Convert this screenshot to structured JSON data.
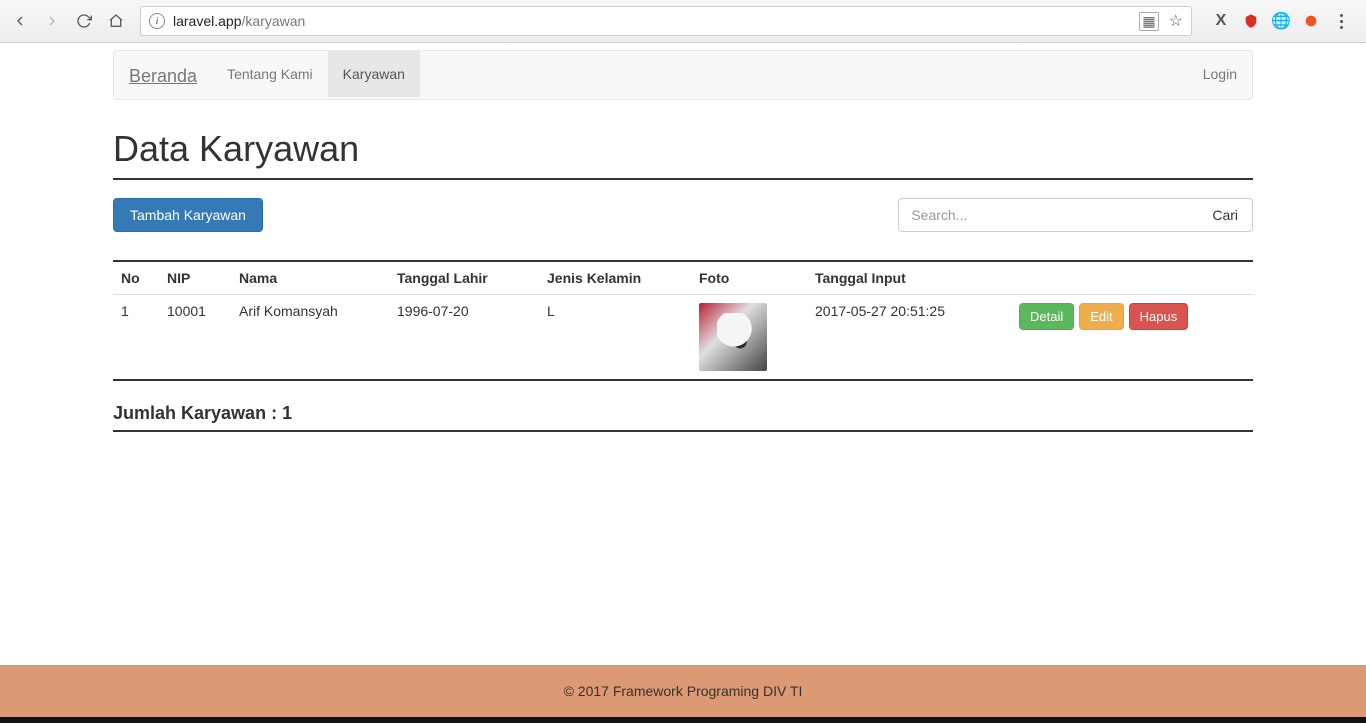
{
  "browser": {
    "url_host": "laravel.app",
    "url_path": "/karyawan"
  },
  "nav": {
    "brand": "Beranda",
    "items": [
      {
        "label": "Tentang Kami",
        "active": false
      },
      {
        "label": "Karyawan",
        "active": true
      }
    ],
    "login": "Login"
  },
  "page": {
    "title": "Data Karyawan",
    "add_button": "Tambah Karyawan",
    "search_placeholder": "Search...",
    "search_button": "Cari"
  },
  "table": {
    "headers": {
      "no": "No",
      "nip": "NIP",
      "nama": "Nama",
      "tgl_lahir": "Tanggal Lahir",
      "jk": "Jenis Kelamin",
      "foto": "Foto",
      "tgl_input": "Tanggal Input"
    },
    "rows": [
      {
        "no": "1",
        "nip": "10001",
        "nama": "Arif Komansyah",
        "tgl_lahir": "1996-07-20",
        "jk": "L",
        "tgl_input": "2017-05-27 20:51:25"
      }
    ],
    "actions": {
      "detail": "Detail",
      "edit": "Edit",
      "hapus": "Hapus"
    }
  },
  "summary": {
    "label": "Jumlah Karyawan : ",
    "count": "1"
  },
  "footer": "© 2017 Framework Programing DIV TI"
}
